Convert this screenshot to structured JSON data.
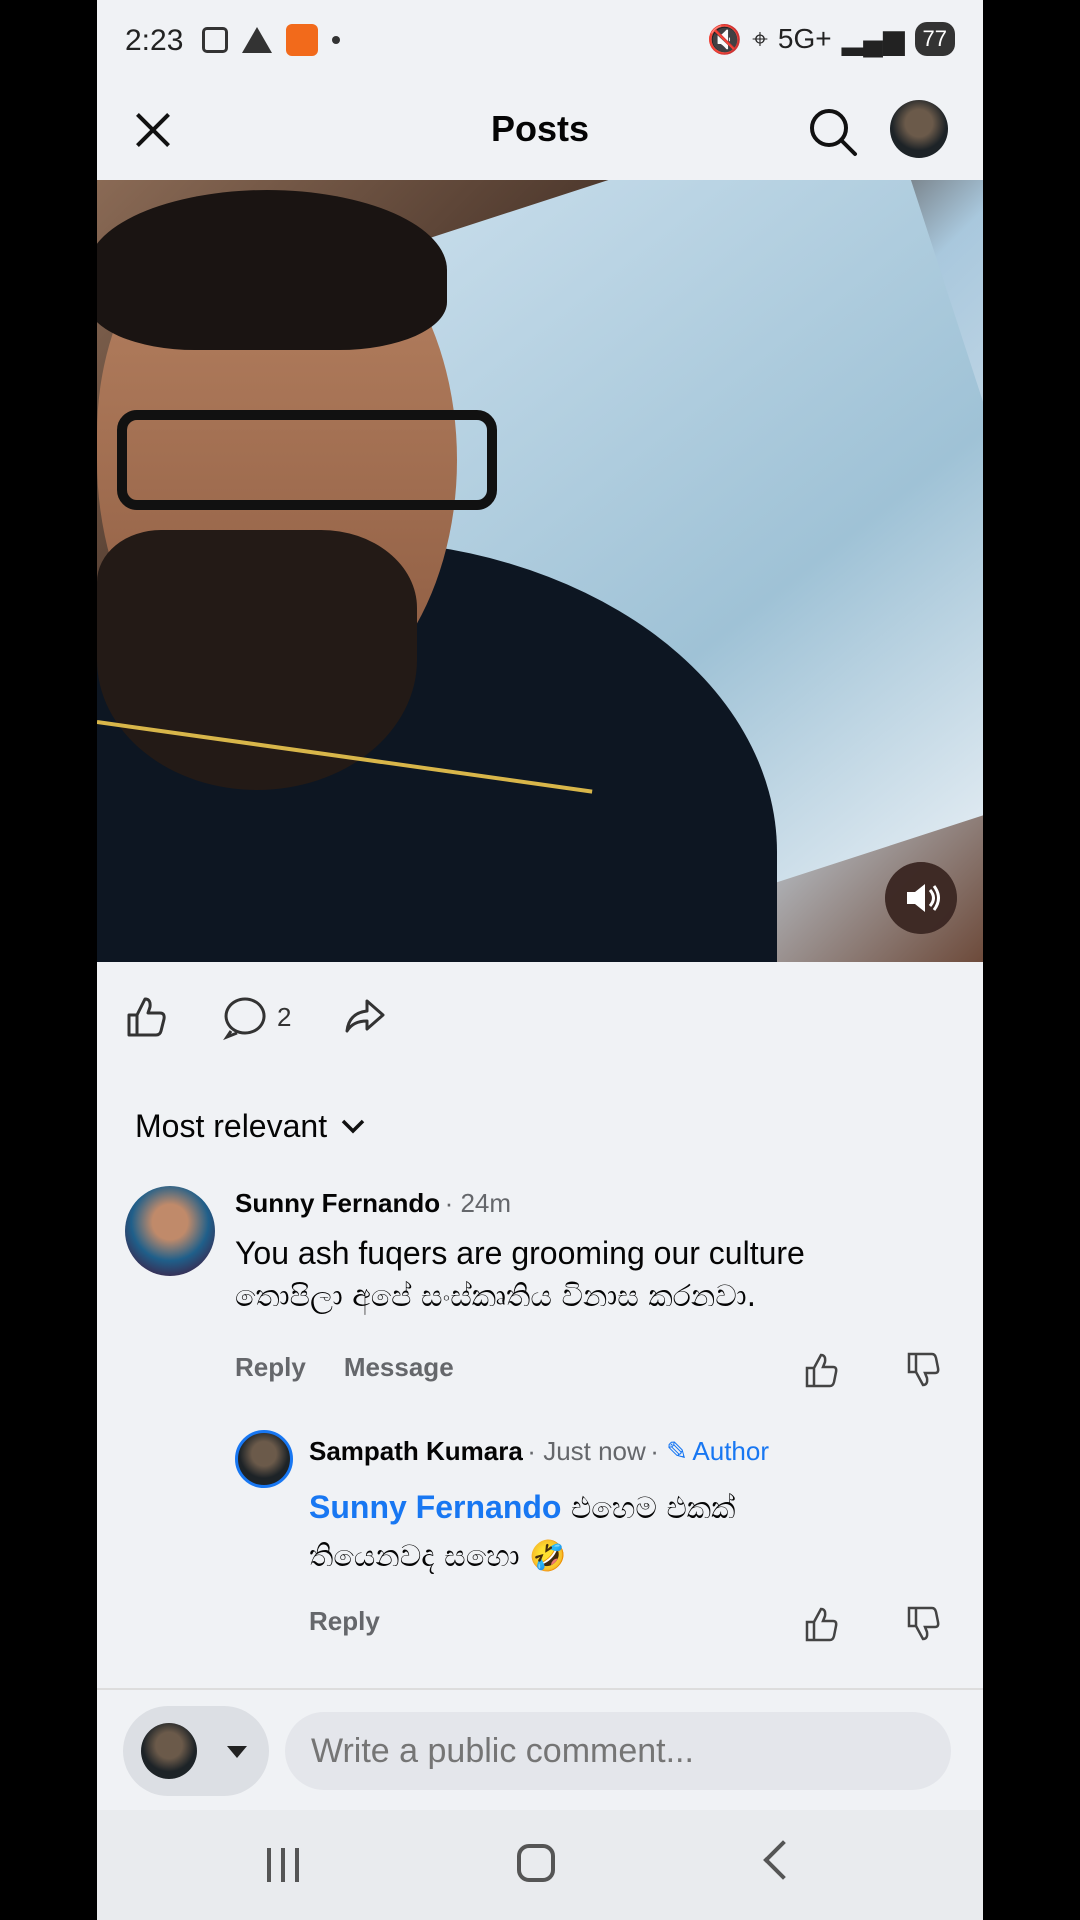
{
  "status_bar": {
    "time": "2:23",
    "network": "5G+",
    "battery": "77"
  },
  "header": {
    "title": "Posts"
  },
  "actions": {
    "comment_count": "2"
  },
  "sort": {
    "label": "Most relevant"
  },
  "comments": [
    {
      "name": "Sunny Fernando",
      "time": "24m",
      "text_line1": "You ash fuqers are grooming our culture",
      "text_line2": "තොපිලා අපේ සංස්කෘතිය විනාස කරනවා.",
      "reply_label": "Reply",
      "message_label": "Message"
    },
    {
      "name": "Sampath Kumara",
      "time": "Just now",
      "badge": "Author",
      "mention": "Sunny Fernando",
      "text_rest": " එහෙම එකක්",
      "text_line2": "තියෙනවද සහො 🤣",
      "reply_label": "Reply"
    }
  ],
  "composer": {
    "placeholder": "Write a public comment..."
  },
  "colors": {
    "accent": "#1877f2",
    "background": "#f0f2f5"
  }
}
